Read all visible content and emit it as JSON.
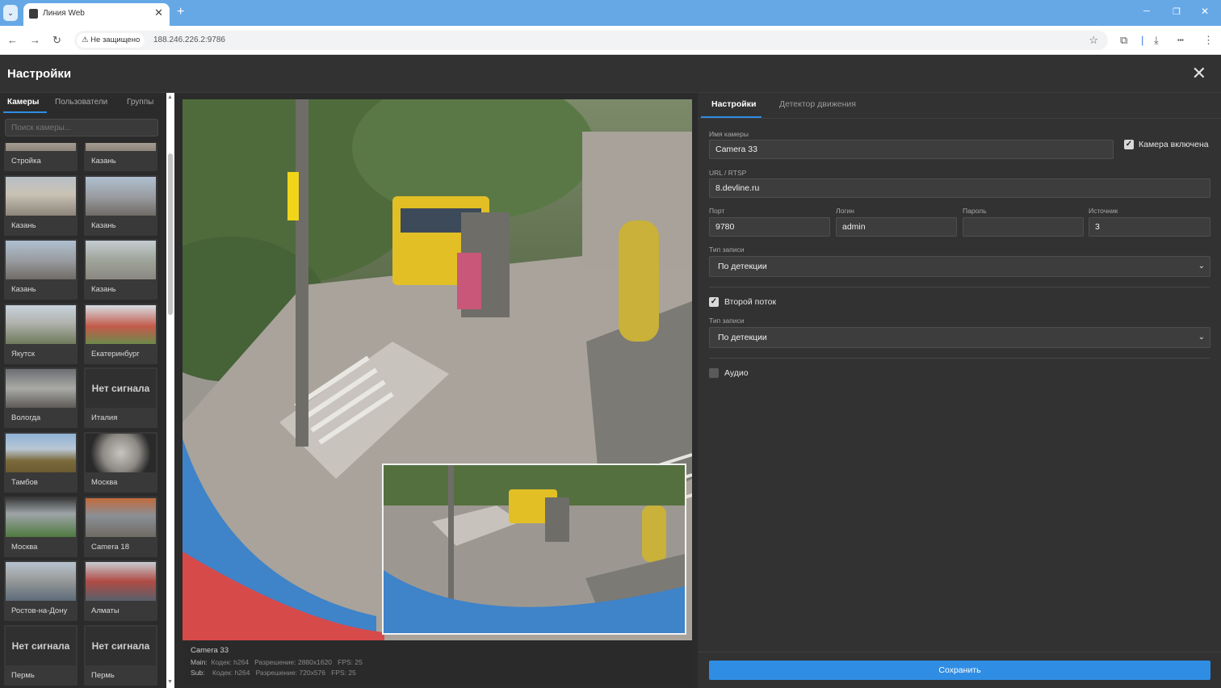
{
  "browser": {
    "tab_title": "Линия Web",
    "security_label": "Не защищено",
    "url": "188.246.226.2:9786"
  },
  "app": {
    "title": "Настройки"
  },
  "sidebar": {
    "tabs": [
      "Камеры",
      "Пользователи",
      "Группы"
    ],
    "search_placeholder": "Поиск камеры...",
    "no_signal_text": "Нет сигнала",
    "cameras": [
      {
        "label": "Стройка",
        "thumb": "construction"
      },
      {
        "label": "Казань",
        "thumb": "construction"
      },
      {
        "label": "Казань",
        "thumb": "construction"
      },
      {
        "label": "Казань",
        "thumb": "city"
      },
      {
        "label": "Казань",
        "thumb": "city"
      },
      {
        "label": "Казань",
        "thumb": "road"
      },
      {
        "label": "Якутск",
        "thumb": "field"
      },
      {
        "label": "Екатеринбург",
        "thumb": "stadium"
      },
      {
        "label": "Вологда",
        "thumb": "indoor"
      },
      {
        "label": "Италия",
        "thumb": "nosignal"
      },
      {
        "label": "Тамбов",
        "thumb": "landscape"
      },
      {
        "label": "Москва",
        "thumb": "fisheye"
      },
      {
        "label": "Москва",
        "thumb": "street"
      },
      {
        "label": "Camera 18",
        "thumb": "town"
      },
      {
        "label": "Ростов-на-Дону",
        "thumb": "parking"
      },
      {
        "label": "Алматы",
        "thumb": "office"
      },
      {
        "label": "Пермь",
        "thumb": "nosignal"
      },
      {
        "label": "Пермь",
        "thumb": "nosignal"
      }
    ]
  },
  "video": {
    "camera_name": "Camera 33",
    "main": {
      "label": "Main:",
      "codec": "Кодек: h264",
      "resolution": "Разрешение: 2880x1620",
      "fps": "FPS: 25"
    },
    "sub": {
      "label": "Sub:",
      "codec": "Кодек: h264",
      "resolution": "Разрешение: 720x576",
      "fps": "FPS: 25"
    }
  },
  "settings": {
    "tabs": [
      "Настройки",
      "Детектор движения"
    ],
    "camera_name_label": "Имя камеры",
    "camera_name_value": "Camera 33",
    "camera_enabled_label": "Камера включена",
    "camera_enabled": true,
    "url_label": "URL / RTSP",
    "url_value": "8.devline.ru",
    "port_label": "Порт",
    "port_value": "9780",
    "login_label": "Логин",
    "login_value": "admin",
    "password_label": "Пароль",
    "password_value": "",
    "source_label": "Источник",
    "source_value": "3",
    "record_type_label": "Тип записи",
    "record_type_value": "По детекции",
    "second_stream_label": "Второй поток",
    "second_stream": true,
    "record_type2_label": "Тип записи",
    "record_type2_value": "По детекции",
    "audio_label": "Аудио",
    "audio": false,
    "save_label": "Сохранить"
  },
  "colors": {
    "accent": "#2f8de4",
    "chrome_tabbar": "#66a8e6",
    "background": "#2b2b2b"
  }
}
